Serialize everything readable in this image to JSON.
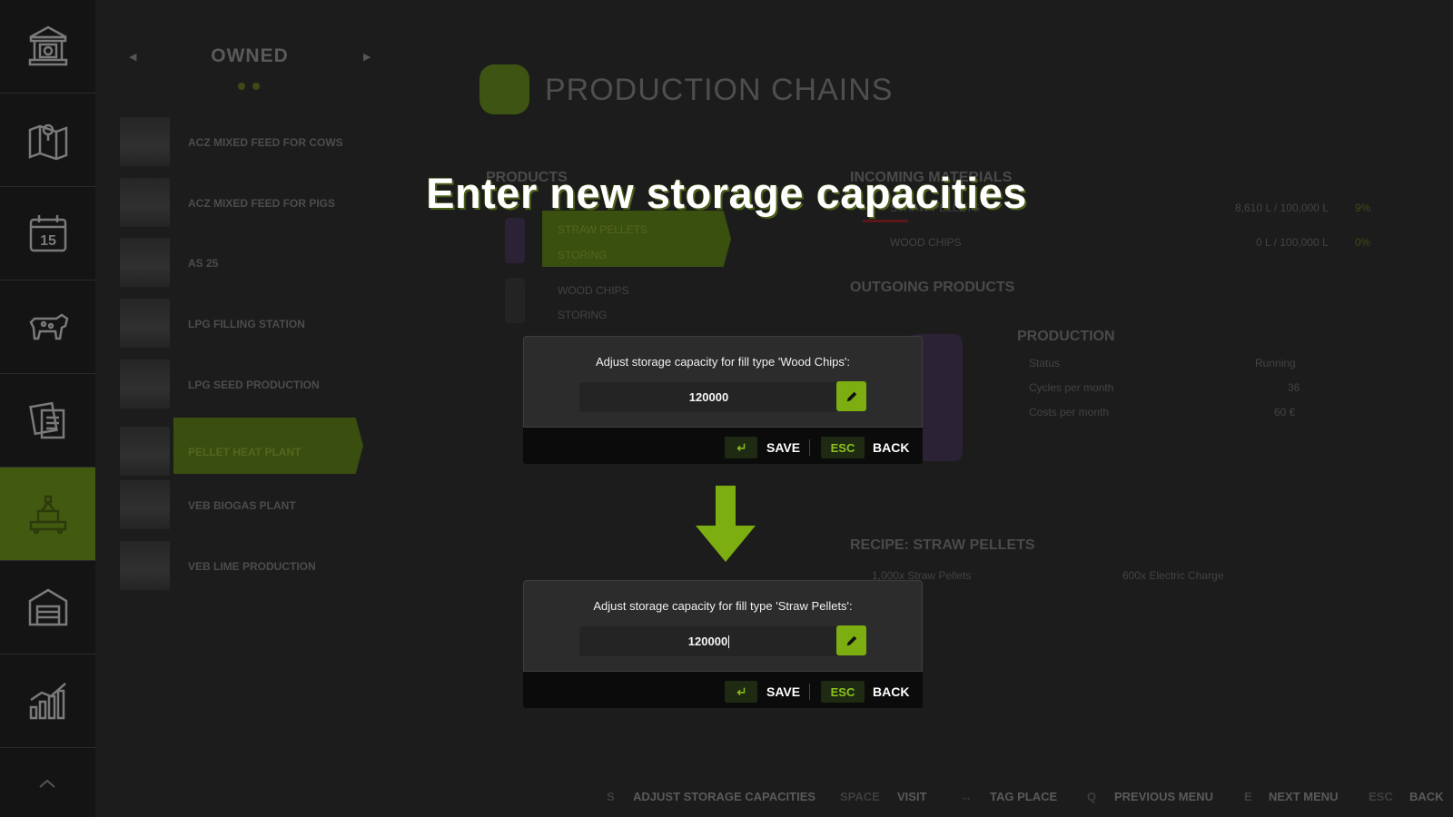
{
  "headline": "Enter new storage capacities",
  "list_panel": {
    "title": "OWNED",
    "items": [
      {
        "label": "ACZ MIXED FEED FOR COWS"
      },
      {
        "label": "ACZ MIXED FEED FOR PIGS"
      },
      {
        "label": "AS 25"
      },
      {
        "label": "LPG FILLING STATION"
      },
      {
        "label": "LPG SEED PRODUCTION"
      },
      {
        "label": "PELLET HEAT PLANT"
      },
      {
        "label": "VEB BIOGAS PLANT"
      },
      {
        "label": "VEB LIME PRODUCTION"
      }
    ],
    "selected_index": 5
  },
  "rail": {
    "icons": [
      "bank-icon",
      "map-icon",
      "calendar-icon",
      "cow-icon",
      "contracts-icon",
      "production-icon",
      "garage-icon",
      "stats-icon"
    ],
    "calendar_day": "15",
    "active_index": 5
  },
  "main": {
    "title": "PRODUCTION CHAINS",
    "products_heading": "PRODUCTS",
    "products": [
      {
        "name": "STRAW PELLETS",
        "status": "STORING"
      },
      {
        "name": "WOOD CHIPS",
        "status": "STORING"
      }
    ],
    "incoming_heading": "INCOMING MATERIALS",
    "incoming": [
      {
        "name": "STRAW PELLETS",
        "amount": "8,610 L / 100,000 L",
        "percent": "9%"
      },
      {
        "name": "WOOD CHIPS",
        "amount": "0 L / 100,000 L",
        "percent": "0%"
      }
    ],
    "outgoing_heading": "OUTGOING PRODUCTS",
    "production_heading": "PRODUCTION",
    "production_rows": [
      {
        "label": "Status",
        "value": "Running"
      },
      {
        "label": "Cycles per month",
        "value": "36"
      },
      {
        "label": "Costs per month",
        "value": "60 €"
      }
    ],
    "recipe_heading": "RECIPE: STRAW PELLETS",
    "recipe_input": "1,000x Straw Pellets",
    "recipe_output": "600x Electric Charge"
  },
  "dialogs": [
    {
      "message": "Adjust storage capacity for fill type 'Wood Chips':",
      "value": "120000",
      "save_label": "SAVE",
      "esc_key": "ESC",
      "back_label": "BACK"
    },
    {
      "message": "Adjust storage capacity for fill type 'Straw Pellets':",
      "value": "120000",
      "save_label": "SAVE",
      "esc_key": "ESC",
      "back_label": "BACK"
    }
  ],
  "bottom_bar": [
    {
      "key": "S",
      "label": "ADJUST STORAGE CAPACITIES"
    },
    {
      "key": "SPACE",
      "label": "VISIT"
    },
    {
      "key": "↔",
      "label": "TAG PLACE"
    },
    {
      "key": "Q",
      "label": "PREVIOUS MENU"
    },
    {
      "key": "E",
      "label": "NEXT MENU"
    },
    {
      "key": "ESC",
      "label": "BACK"
    }
  ],
  "colors": {
    "accent": "#7cae11",
    "background": "#1c1c1c",
    "dialog": "#2c2c2c",
    "footer": "#0b0b0b"
  }
}
